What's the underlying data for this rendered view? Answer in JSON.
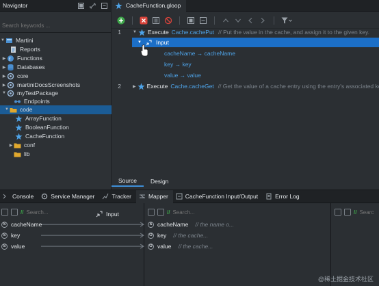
{
  "navigator": {
    "title": "Navigator",
    "search_placeholder": "Search keywords ...",
    "items": [
      {
        "label": "Martini"
      },
      {
        "label": "Reports"
      },
      {
        "label": "Functions"
      },
      {
        "label": "Databases"
      },
      {
        "label": "core"
      },
      {
        "label": "martiniDocsScreenshots"
      },
      {
        "label": "myTestPackage"
      },
      {
        "label": "Endpoints"
      },
      {
        "label": "code"
      },
      {
        "label": "ArrayFunction"
      },
      {
        "label": "BooleanFunction"
      },
      {
        "label": "CacheFunction"
      },
      {
        "label": "conf"
      },
      {
        "label": "lib"
      }
    ]
  },
  "editor": {
    "tab_label": "CacheFunction.gloop",
    "lines": [
      {
        "num": "1",
        "keyword": "Execute",
        "service": "Cache.cachePut",
        "comment": "// Put the value in the cache, and assign it to the given key."
      },
      {
        "num": "2",
        "keyword": "Execute",
        "service": "Cache.cacheGet",
        "comment": "// Get the value of a cache entry using the entry's associated key."
      }
    ],
    "input_label": "Input",
    "mappings": [
      "cacheName → cacheName",
      "key → key",
      "value → value"
    ],
    "bottom_tabs": [
      "Source",
      "Design"
    ]
  },
  "lower": {
    "tabs": [
      "Console",
      "Service Manager",
      "Tracker",
      "Mapper",
      "CacheFunction Input/Output",
      "Error Log"
    ],
    "search_placeholder": "Search...",
    "input_label": "Input",
    "left_fields": [
      "cacheName",
      "key",
      "value"
    ],
    "right_fields": [
      {
        "name": "cacheName",
        "comment": "// the name o..."
      },
      {
        "name": "key",
        "comment": "// the cache..."
      },
      {
        "name": "value",
        "comment": "// the cache..."
      }
    ]
  },
  "watermark": "@稀土掘金技术社区",
  "colors": {
    "accent": "#1c6fc7",
    "selected": "#1b5c96",
    "link": "#4ea3e8",
    "run": "#3ea54a",
    "stop": "#d9443b"
  }
}
